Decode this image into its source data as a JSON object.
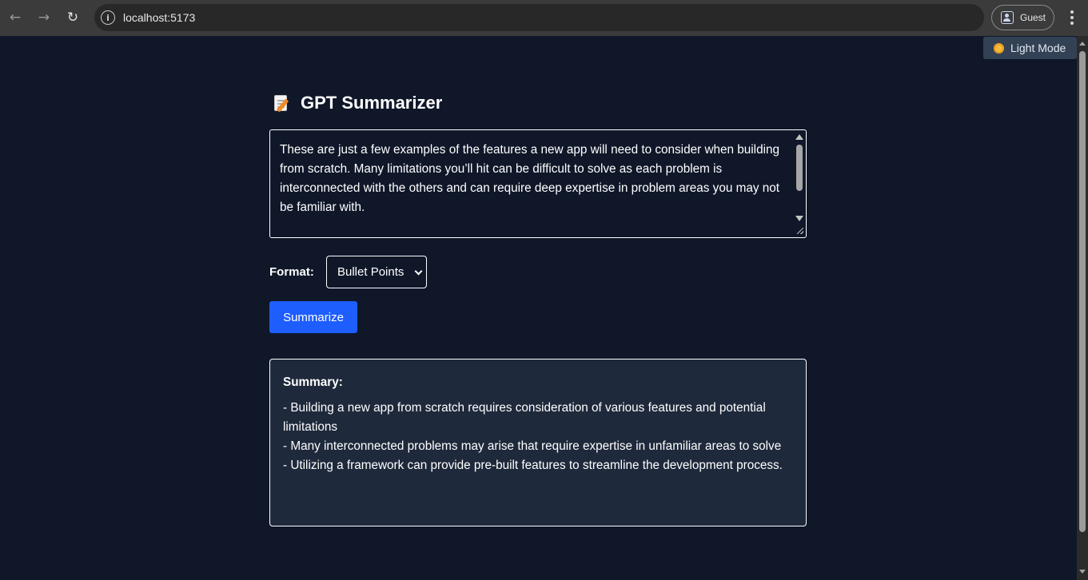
{
  "browser": {
    "url": "localhost:5173",
    "profile_label": "Guest",
    "back_icon": "←",
    "forward_icon": "→",
    "reload_icon": "↻",
    "info_icon": "i"
  },
  "theme_toggle": {
    "label": "Light Mode",
    "icon": "sun-icon"
  },
  "app": {
    "title": "GPT Summarizer",
    "title_icon": "memo-icon",
    "input_text": "These are just a few examples of the features a new app will need to consider when building from scratch. Many limitations you’ll hit can be difficult to solve as each problem is interconnected with the others and can require deep expertise in problem areas you may not be familiar with.",
    "format_label": "Format:",
    "format_selected": "Bullet Points",
    "summarize_label": "Summarize",
    "summary": {
      "heading": "Summary:",
      "lines": [
        "- Building a new app from scratch requires consideration of various features and potential limitations",
        "- Many interconnected problems may arise that require expertise in unfamiliar areas to solve",
        "- Utilizing a framework can provide pre-built features to streamline the development process."
      ]
    }
  },
  "colors": {
    "page_bg": "#0f1729",
    "summary_bg": "#1e293b",
    "button_accent": "#1e5eff",
    "toggle_bg": "#334155"
  }
}
